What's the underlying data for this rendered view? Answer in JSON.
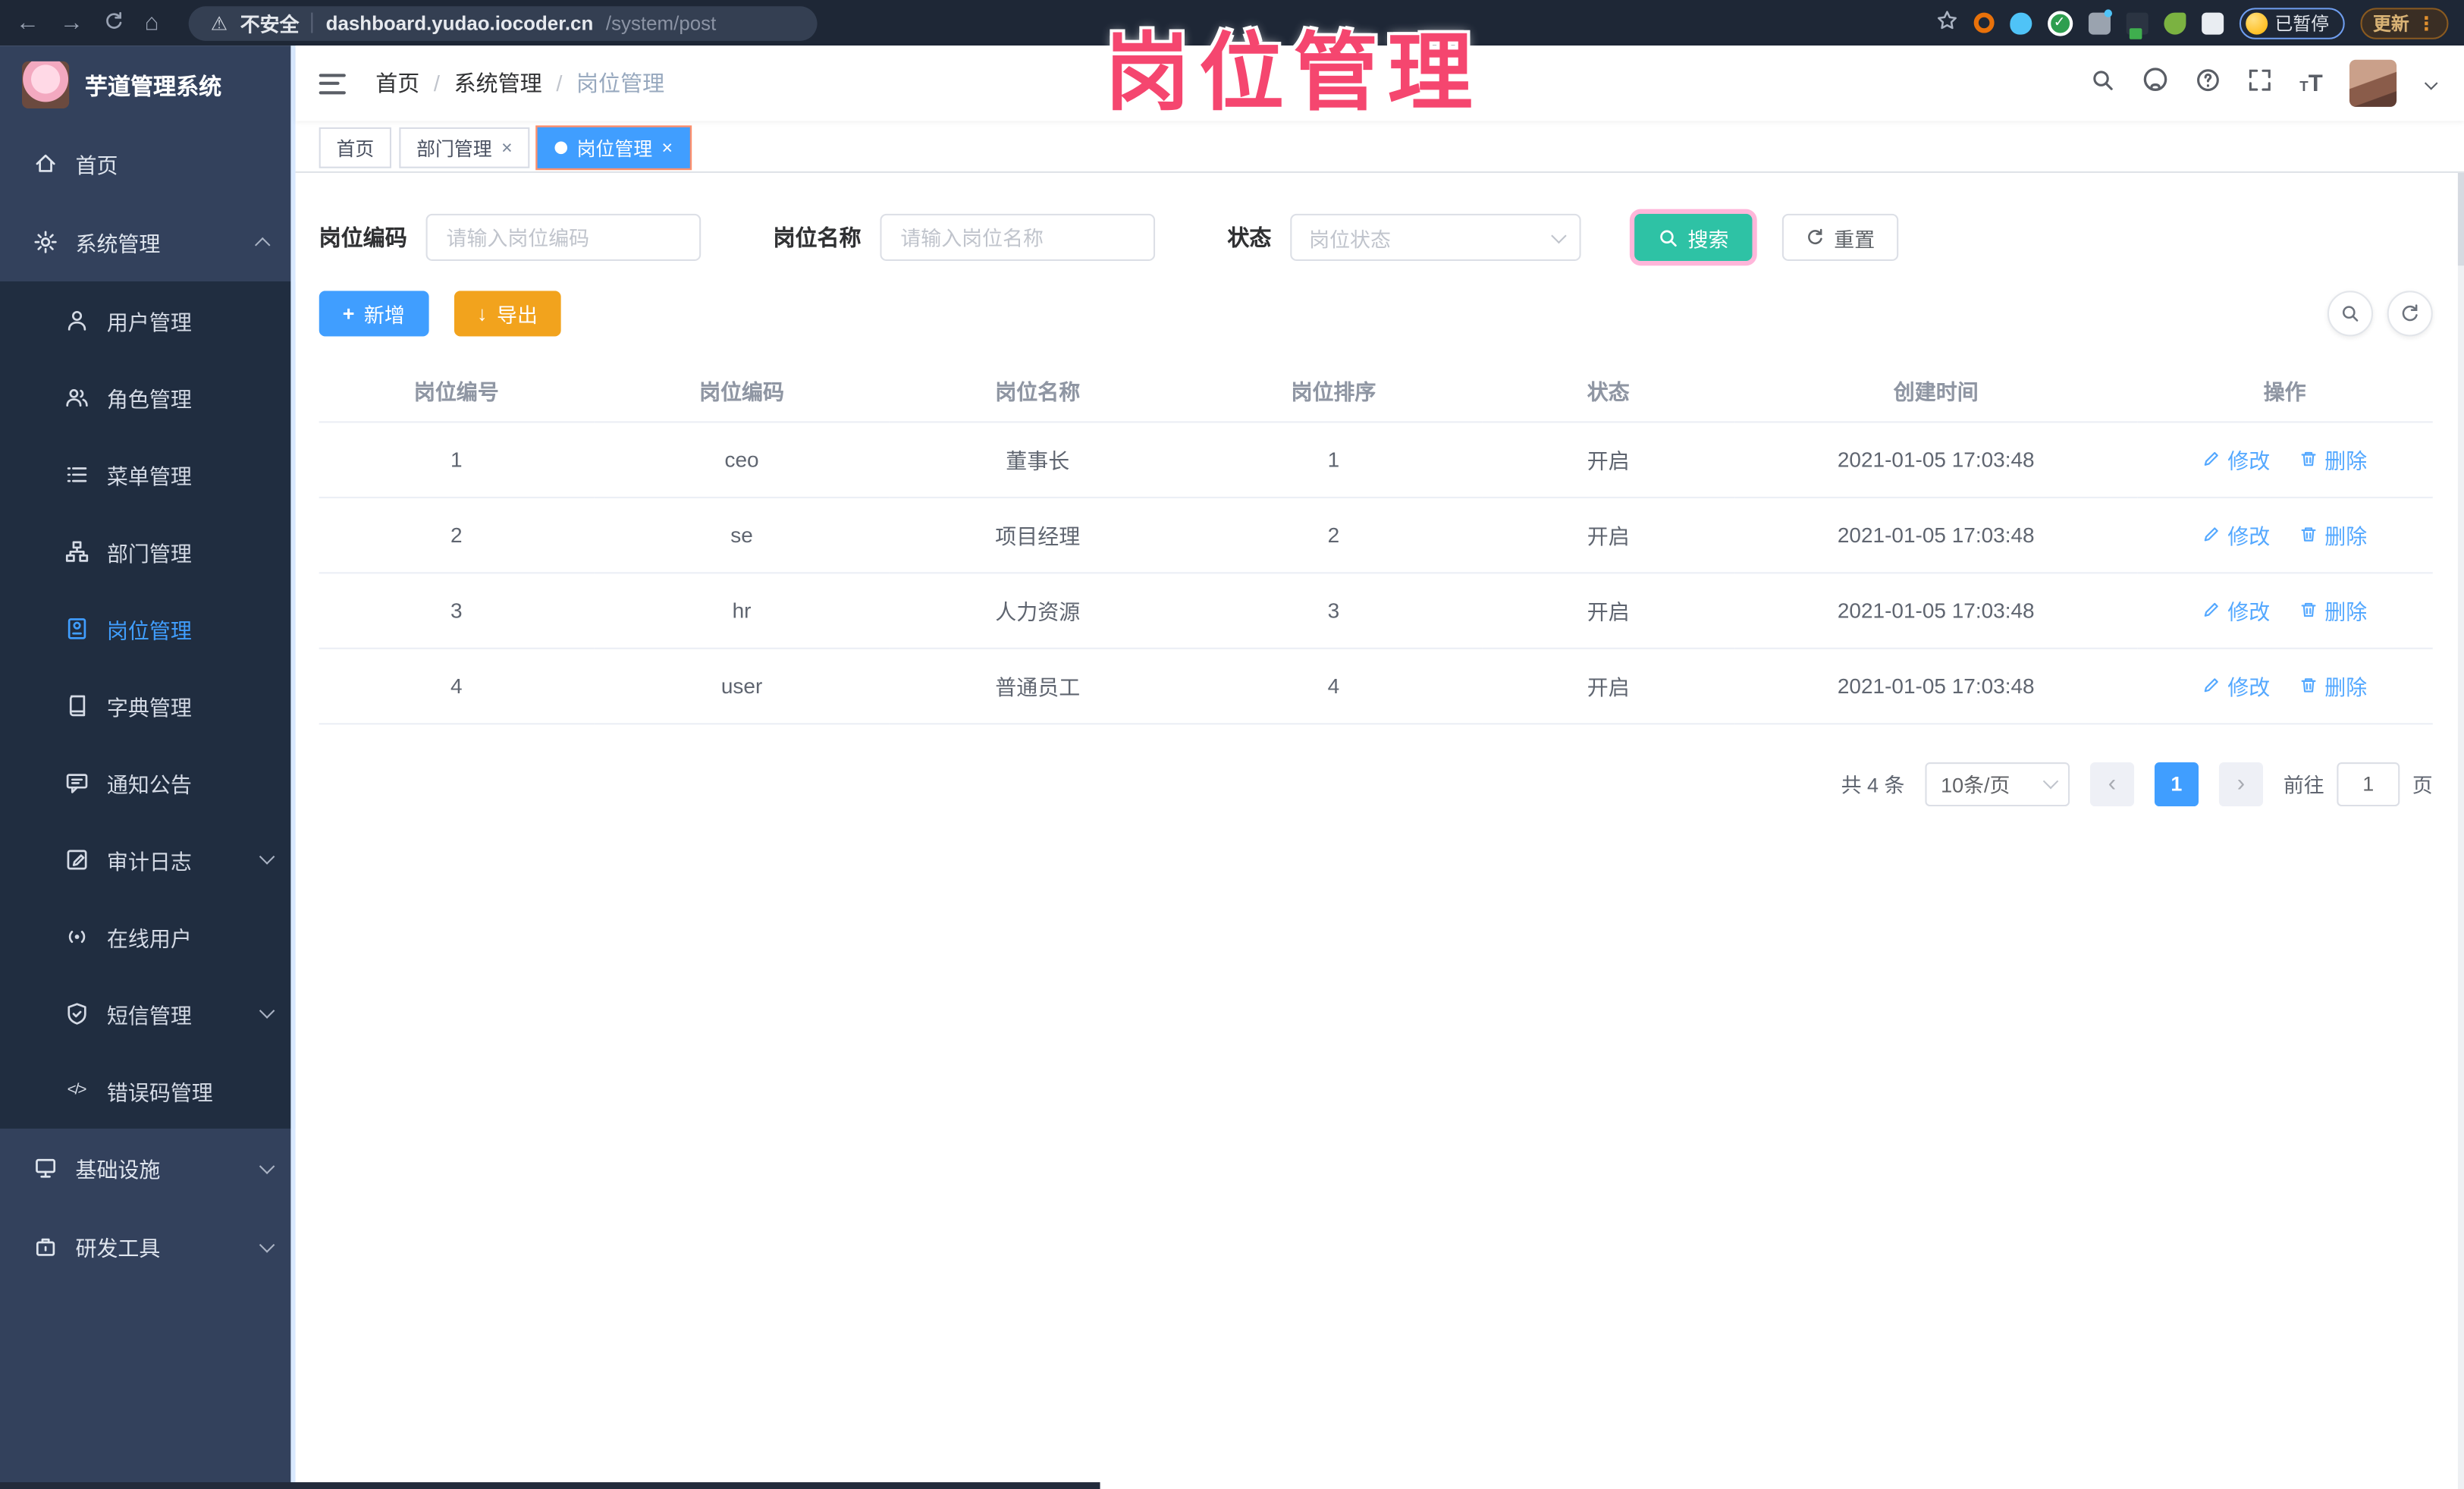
{
  "colors": {
    "accent": "#409eff",
    "search_teal": "#2ec2a5",
    "export_orange": "#f2a31d",
    "annotation_pink": "#f5466f",
    "sidebar_bg": "#33415c",
    "submenu_bg": "#202d40"
  },
  "glyphs": {
    "back": "←",
    "forward": "→",
    "home": "⌂",
    "warning": "⚠",
    "star": "☆",
    "kebab": "⋮",
    "close": "×",
    "caret_prev": "‹",
    "caret_next": "›",
    "plus": "+",
    "download": "↓",
    "font_size_big": "T",
    "font_size_small": "T",
    "code": "</>",
    "question": "?"
  },
  "browser": {
    "security_label": "不安全",
    "url_host": "dashboard.yudao.iocoder.cn",
    "url_path": "/system/post",
    "paused_badge": "已暂停",
    "update_label": "更新"
  },
  "overlay": {
    "title": "岗位管理"
  },
  "sidebar": {
    "app_title": "芋道管理系统",
    "items": [
      {
        "label": "首页"
      },
      {
        "label": "系统管理"
      },
      {
        "label": "用户管理"
      },
      {
        "label": "角色管理"
      },
      {
        "label": "菜单管理"
      },
      {
        "label": "部门管理"
      },
      {
        "label": "岗位管理"
      },
      {
        "label": "字典管理"
      },
      {
        "label": "通知公告"
      },
      {
        "label": "审计日志"
      },
      {
        "label": "在线用户"
      },
      {
        "label": "短信管理"
      },
      {
        "label": "错误码管理"
      },
      {
        "label": "基础设施"
      },
      {
        "label": "研发工具"
      }
    ]
  },
  "breadcrumb": {
    "items": [
      "首页",
      "系统管理",
      "岗位管理"
    ],
    "separator": "/"
  },
  "tabs": {
    "items": [
      {
        "label": "首页"
      },
      {
        "label": "部门管理"
      },
      {
        "label": "岗位管理"
      }
    ]
  },
  "filters": {
    "code_label": "岗位编码",
    "code_placeholder": "请输入岗位编码",
    "name_label": "岗位名称",
    "name_placeholder": "请输入岗位名称",
    "status_label": "状态",
    "status_placeholder": "岗位状态",
    "search_label": "搜索",
    "reset_label": "重置"
  },
  "toolbar": {
    "add_label": "新增",
    "export_label": "导出"
  },
  "table": {
    "columns": [
      "岗位编号",
      "岗位编码",
      "岗位名称",
      "岗位排序",
      "状态",
      "创建时间",
      "操作"
    ],
    "rows": [
      {
        "no": "1",
        "code": "ceo",
        "name": "董事长",
        "sort": "1",
        "status": "开启",
        "created": "2021-01-05 17:03:48"
      },
      {
        "no": "2",
        "code": "se",
        "name": "项目经理",
        "sort": "2",
        "status": "开启",
        "created": "2021-01-05 17:03:48"
      },
      {
        "no": "3",
        "code": "hr",
        "name": "人力资源",
        "sort": "3",
        "status": "开启",
        "created": "2021-01-05 17:03:48"
      },
      {
        "no": "4",
        "code": "user",
        "name": "普通员工",
        "sort": "4",
        "status": "开启",
        "created": "2021-01-05 17:03:48"
      }
    ],
    "edit_label": "修改",
    "delete_label": "删除"
  },
  "pagination": {
    "total_text": "共 4 条",
    "page_size": "10条/页",
    "current_page": "1",
    "goto_label": "前往",
    "goto_value": "1",
    "page_unit": "页"
  }
}
